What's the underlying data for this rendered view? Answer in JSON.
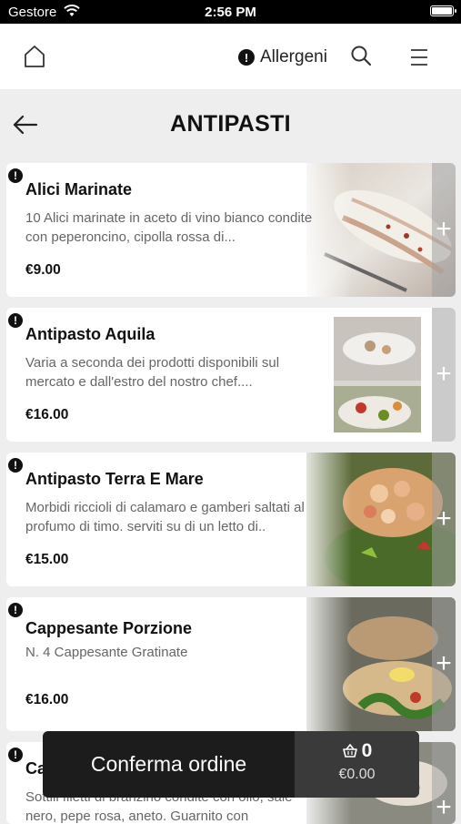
{
  "status": {
    "carrier": "Gestore",
    "time": "2:56 PM"
  },
  "nav": {
    "allergens_label": "Allergeni"
  },
  "page": {
    "title": "ANTIPASTI"
  },
  "items": [
    {
      "name": "Alici Marinate",
      "description": "10 Alici marinate in aceto di vino bianco condite con peperoncino, cipolla rossa di...",
      "price": "€9.00"
    },
    {
      "name": "Antipasto Aquila",
      "description": "Varia a seconda dei prodotti disponibili sul mercato e dall'estro del nostro chef....",
      "price": "€16.00"
    },
    {
      "name": "Antipasto Terra E Mare",
      "description": "Morbidi riccioli di calamaro e gamberi saltati al profumo di timo.  serviti su di un letto di..",
      "price": "€15.00"
    },
    {
      "name": "Cappesante Porzione",
      "description": "N. 4 Cappesante Gratinate",
      "price": "€16.00"
    },
    {
      "name": "Ca",
      "description": "Sottili filetti di branzino condite con olio, sale nero, pepe rosa, aneto.  Guarnito con",
      "price": ""
    }
  ],
  "order": {
    "confirm_label": "Conferma ordine",
    "cart_count": "0",
    "cart_total": "€0.00"
  },
  "colors": {
    "dark_bar": "#1c1c1c",
    "cart_bg": "#3a3a3a",
    "page_bg": "#eeeeee"
  }
}
